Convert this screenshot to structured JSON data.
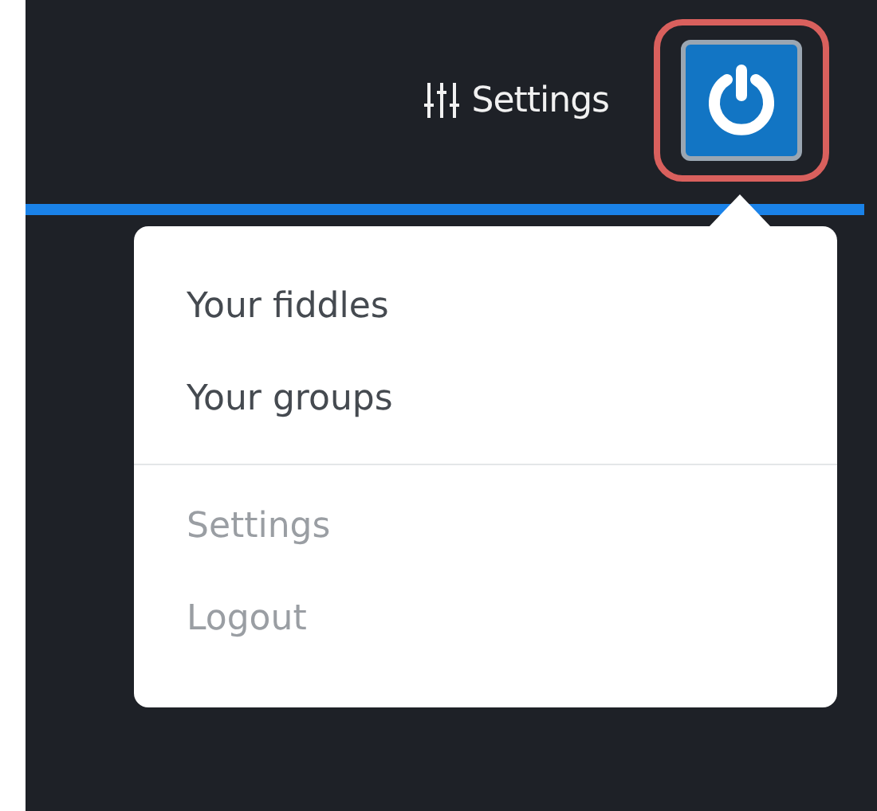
{
  "navbar": {
    "settings_link": {
      "label": "Settings"
    },
    "power_button": {
      "highlighted": true
    }
  },
  "dropdown": {
    "groups": [
      [
        {
          "label": "Your fiddles",
          "muted": false
        },
        {
          "label": "Your groups",
          "muted": false
        }
      ],
      [
        {
          "label": "Settings",
          "muted": true
        },
        {
          "label": "Logout",
          "muted": true
        }
      ]
    ]
  }
}
